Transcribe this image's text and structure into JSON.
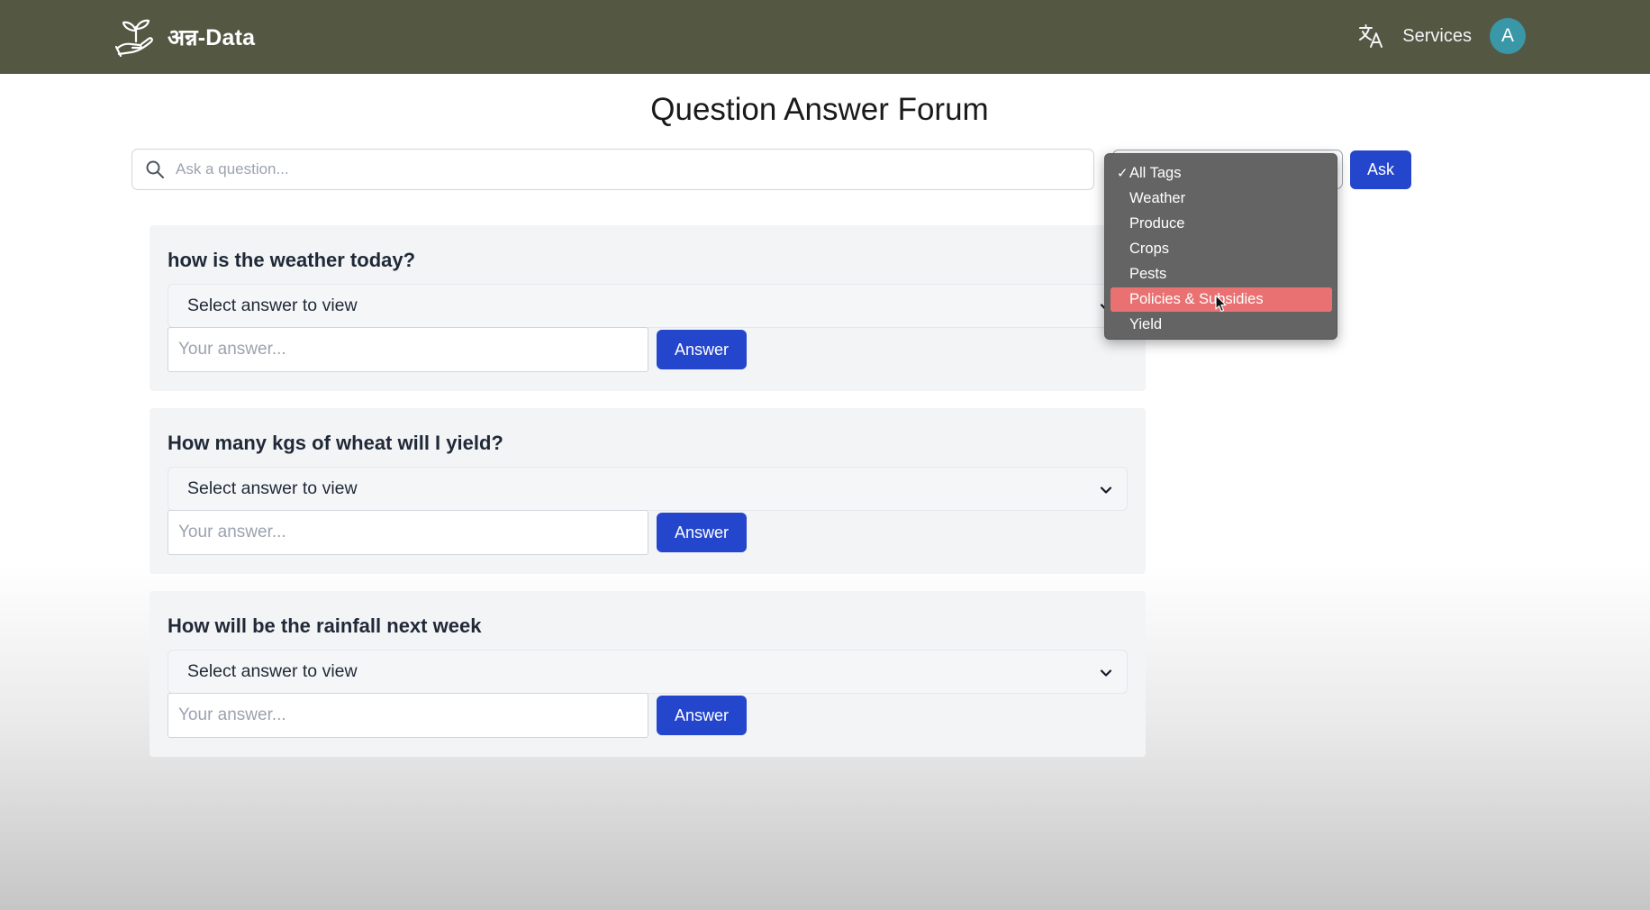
{
  "navbar": {
    "brand_name": "अन्न-Data",
    "logo_icon": "plant-in-hand-icon",
    "translate_icon": "translate-icon",
    "services_label": "Services",
    "avatar_initial": "A",
    "background_color": "#545742"
  },
  "page": {
    "title": "Question Answer Forum"
  },
  "search": {
    "placeholder": "Ask a question...",
    "value": ""
  },
  "tag_filter": {
    "options": [
      {
        "label": "All Tags",
        "checked": true
      },
      {
        "label": "Weather"
      },
      {
        "label": "Produce"
      },
      {
        "label": "Crops"
      },
      {
        "label": "Pests"
      },
      {
        "label": "Policies & Subsidies",
        "hovered": true
      },
      {
        "label": "Yield"
      }
    ],
    "highlight_color": "#e97171"
  },
  "ask_button_label": "Ask",
  "questions": [
    {
      "title": "how is the weather today?",
      "answer_select_label": "Select answer to view",
      "answer_placeholder": "Your answer...",
      "answer_button_label": "Answer"
    },
    {
      "title": "How many kgs of wheat will I yield?",
      "answer_select_label": "Select answer to view",
      "answer_placeholder": "Your answer...",
      "answer_button_label": "Answer"
    },
    {
      "title": "How will be the rainfall next week",
      "answer_select_label": "Select answer to view",
      "answer_placeholder": "Your answer...",
      "answer_button_label": "Answer"
    }
  ],
  "colors": {
    "primary_button": "#2446cc",
    "card_background": "#f3f4f6",
    "avatar": "#3a97a8"
  }
}
